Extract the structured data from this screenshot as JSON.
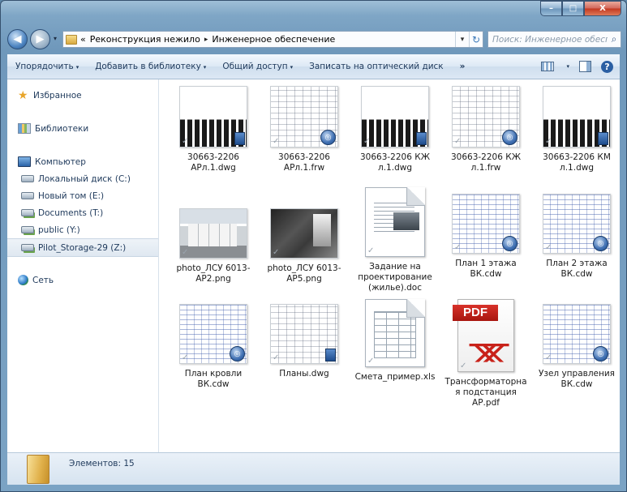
{
  "window": {
    "caption_buttons": {
      "min": "–",
      "max": "□",
      "close": "X"
    }
  },
  "address": {
    "recent_arrow": "▾",
    "overflow": "«",
    "crumbs": [
      "Реконструкция нежило",
      "Инженерное обеспечение"
    ],
    "separator": "▸",
    "dropdown": "▾",
    "refresh": "↻"
  },
  "search": {
    "placeholder": "Поиск: Инженерное обеспеч...",
    "icon": "search-icon"
  },
  "toolbar": {
    "organize": "Упорядочить",
    "add_library": "Добавить в библиотеку",
    "share": "Общий доступ",
    "burn": "Записать на оптический диск",
    "more": "»",
    "dd": "▾",
    "help": "?"
  },
  "nav": {
    "favorites": "Избранное",
    "libraries": "Библиотеки",
    "computer": "Компьютер",
    "drives": [
      {
        "label": "Локальный диск (C:)",
        "kind": "drive"
      },
      {
        "label": "Новый том (E:)",
        "kind": "drive"
      },
      {
        "label": "Documents (T:)",
        "kind": "netdrive"
      },
      {
        "label": "public (Y:)",
        "kind": "netdrive"
      },
      {
        "label": "Pilot_Storage-29 (Z:)",
        "kind": "netdrive",
        "selected": true
      }
    ],
    "network": "Сеть"
  },
  "files": [
    {
      "label": "30663-2206 АРл.1.dwg"
    },
    {
      "label": "30663-2206 АРл.1.frw"
    },
    {
      "label": "30663-2206 КЖ л.1.dwg"
    },
    {
      "label": "30663-2206 КЖ л.1.frw"
    },
    {
      "label": "30663-2206 КМ л.1.dwg"
    },
    {
      "label": "photo_ЛСУ 6013-АР2.png"
    },
    {
      "label": "photo_ЛСУ 6013-АР5.png"
    },
    {
      "label": "Задание на проектирование (жилье).doc"
    },
    {
      "label": "План 1 этажа ВК.cdw"
    },
    {
      "label": "План 2 этажа ВК.cdw"
    },
    {
      "label": "План кровли ВК.cdw"
    },
    {
      "label": "Планы.dwg"
    },
    {
      "label": "Смета_пример.xls"
    },
    {
      "label": "Трансформаторная подстанция АР.pdf",
      "pdf_text": "PDF"
    },
    {
      "label": "Узел управления ВК.cdw"
    }
  ],
  "status": {
    "count_text": "Элементов: 15"
  }
}
